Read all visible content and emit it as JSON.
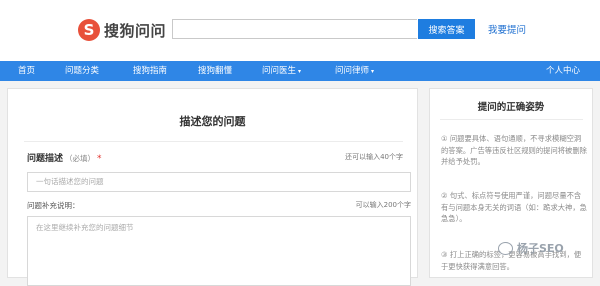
{
  "header": {
    "logo_mark": "S",
    "logo_text": "搜狗问问",
    "search_placeholder": "",
    "search_button": "搜索答案",
    "ask_link": "我要提问"
  },
  "nav": {
    "items": [
      {
        "label": "首页"
      },
      {
        "label": "问题分类"
      },
      {
        "label": "搜狗指南"
      },
      {
        "label": "搜狗翻懂"
      },
      {
        "label": "问问医生",
        "caret": "▾"
      },
      {
        "label": "问问律师",
        "caret": "▾"
      },
      {
        "label": "个人中心"
      }
    ]
  },
  "main": {
    "title": "描述您的问题",
    "question_label": "问题描述",
    "required_note": "（必填）",
    "required_star": "*",
    "question_hint": "还可以输入40个字",
    "question_placeholder": "一句话描述您的问题",
    "supplement_label": "问题补充说明：",
    "supplement_hint": "可以输入200个字",
    "supplement_placeholder": "在这里继续补充您的问题细节"
  },
  "sidebar": {
    "title": "提问的正确姿势",
    "tips": [
      "① 问题要具体、语句通顺，不寻求模糊空洞的答案。广告等违反社区规则的提问将被删除并给予处罚。",
      "② 句式、标点符号使用严谨，问题尽量不含有与问题本身无关的词语（如：跪求大神，急急急）。",
      "③ 打上正确的标签，更容易被高手找到，便于更快获得满意回答。"
    ]
  },
  "watermark": {
    "text": "杨子SEO"
  },
  "colors": {
    "accent": "#2f86e6",
    "button": "#1e7de0",
    "logo": "#e8503a",
    "required": "#e3332e"
  }
}
